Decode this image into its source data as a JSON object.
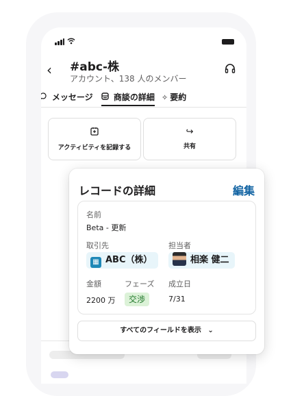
{
  "channel": {
    "title": "#abc-株",
    "subtitle": "アカウント、138 人のメンバー"
  },
  "icons": {
    "back": "‹",
    "wifi": "wifi-icon",
    "headphones": "🎧",
    "message": "💬",
    "deal": "▤",
    "summary": "✧",
    "record": "🗒",
    "share": "↪",
    "building": "▦",
    "chevron": "⌄"
  },
  "tabs": [
    {
      "label": "メッセージ"
    },
    {
      "label": "商談の詳細"
    },
    {
      "label": "要約"
    }
  ],
  "actions": [
    {
      "label": "アクティビティを記録する"
    },
    {
      "label": "共有"
    }
  ],
  "record": {
    "title": "レコードの詳細",
    "edit_label": "編集",
    "name_label": "名前",
    "name_value": "Beta - 更新",
    "account_label": "取引先",
    "account_value": "ABC（株）",
    "owner_label": "担当者",
    "owner_value": "相楽 健二",
    "amount_label": "金額",
    "amount_value": "2200 万",
    "phase_label": "フェーズ",
    "phase_value": "交渉",
    "close_label": "成立日",
    "close_value": "7/31",
    "show_all_label": "すべてのフィールドを表示"
  },
  "colors": {
    "accent_link": "#1264a3",
    "account_chip": "#e8f5fa",
    "phase_badge": "#dcf2d8",
    "phase_text": "#23792d"
  }
}
